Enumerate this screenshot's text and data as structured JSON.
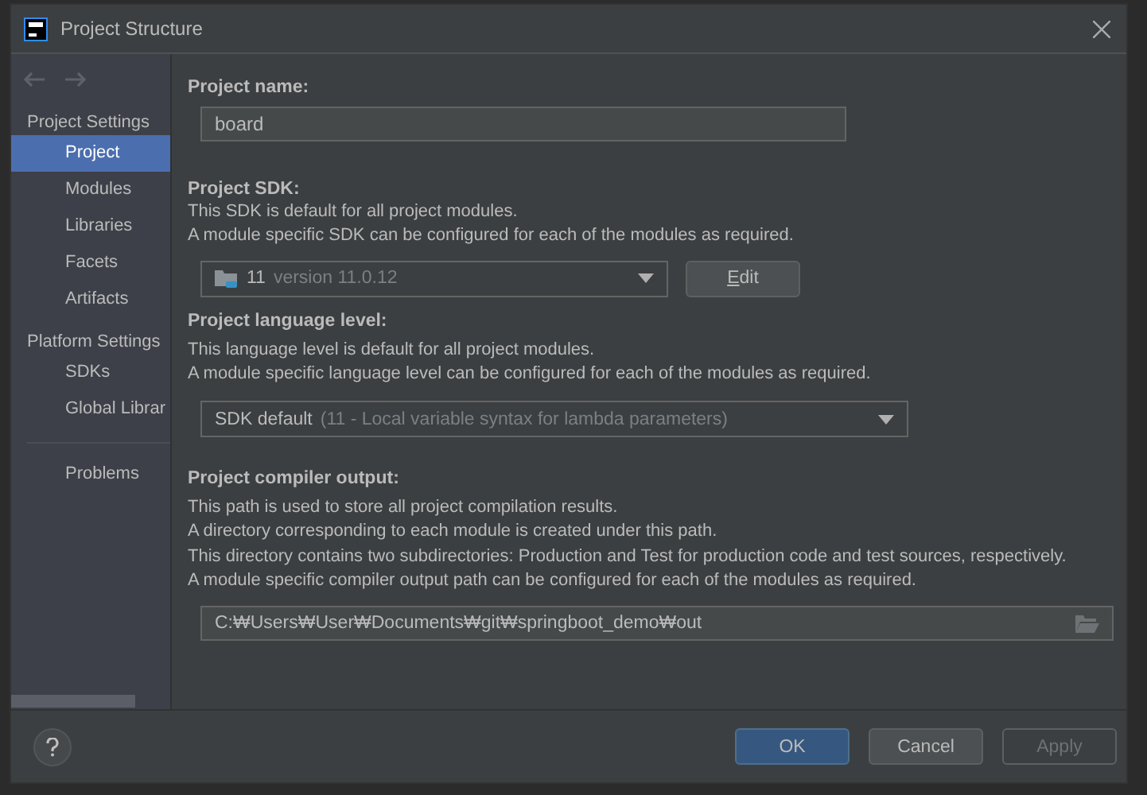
{
  "window": {
    "title": "Project Structure"
  },
  "sidebar": {
    "sections": [
      {
        "label": "Project Settings",
        "items": [
          {
            "label": "Project",
            "selected": true
          },
          {
            "label": "Modules",
            "selected": false
          },
          {
            "label": "Libraries",
            "selected": false
          },
          {
            "label": "Facets",
            "selected": false
          },
          {
            "label": "Artifacts",
            "selected": false
          }
        ]
      },
      {
        "label": "Platform Settings",
        "items": [
          {
            "label": "SDKs",
            "selected": false
          },
          {
            "label": "Global Librar",
            "selected": false
          }
        ]
      }
    ],
    "extra_items": [
      {
        "label": "Problems",
        "selected": false
      }
    ]
  },
  "project_name": {
    "label": "Project name:",
    "value": "board"
  },
  "project_sdk": {
    "label": "Project SDK:",
    "description": [
      "This SDK is default for all project modules.",
      "A module specific SDK can be configured for each of the modules as required."
    ],
    "value": "11",
    "detail": "version 11.0.12",
    "edit_button": "Edit"
  },
  "language_level": {
    "label": "Project language level:",
    "description": [
      "This language level is default for all project modules.",
      "A module specific language level can be configured for each of the modules as required."
    ],
    "value": "SDK default",
    "detail": "(11 - Local variable syntax for lambda parameters)"
  },
  "compiler_output": {
    "label": "Project compiler output:",
    "description": [
      "This path is used to store all project compilation results.",
      "A directory corresponding to each module is created under this path.",
      "This directory contains two subdirectories: Production and Test for production code and test sources, respectively.",
      "A module specific compiler output path can be configured for each of the modules as required."
    ],
    "value": "C:₩Users₩User₩Documents₩git₩springboot_demo₩out"
  },
  "buttons": [
    {
      "label": "OK",
      "default": true,
      "disabled": false
    },
    {
      "label": "Cancel",
      "default": false,
      "disabled": false
    },
    {
      "label": "Apply",
      "default": false,
      "disabled": true
    }
  ]
}
